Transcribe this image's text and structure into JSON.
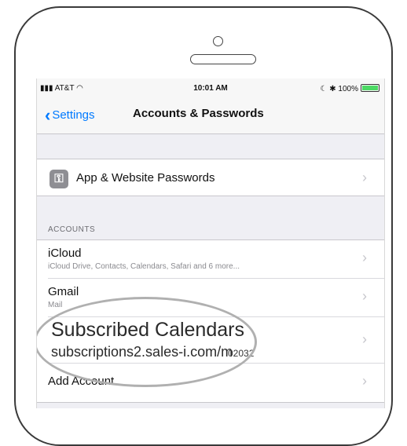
{
  "status_bar": {
    "carrier": "AT&T",
    "time": "10:01 AM",
    "battery": "100%"
  },
  "nav": {
    "back_label": "Settings",
    "title": "Accounts & Passwords"
  },
  "passwords_cell": {
    "label": "App & Website Passwords"
  },
  "accounts_header": "ACCOUNTS",
  "accounts": [
    {
      "title": "iCloud",
      "subtitle": "iCloud Drive, Contacts, Calendars, Safari and 6 more..."
    },
    {
      "title": "Gmail",
      "subtitle": "Mail"
    },
    {
      "title": "Subscribed Calendars",
      "subtitle": "subscriptions2.sales-i.com/m",
      "subtitle_suffix": "02032"
    },
    {
      "title": "Add Account"
    }
  ],
  "colors": {
    "accent": "#007aff",
    "background": "#efeff4",
    "battery": "#4cd964"
  },
  "icons": {
    "key": "key-icon",
    "chevron": "chevron-right-icon",
    "back": "chevron-left-icon"
  }
}
